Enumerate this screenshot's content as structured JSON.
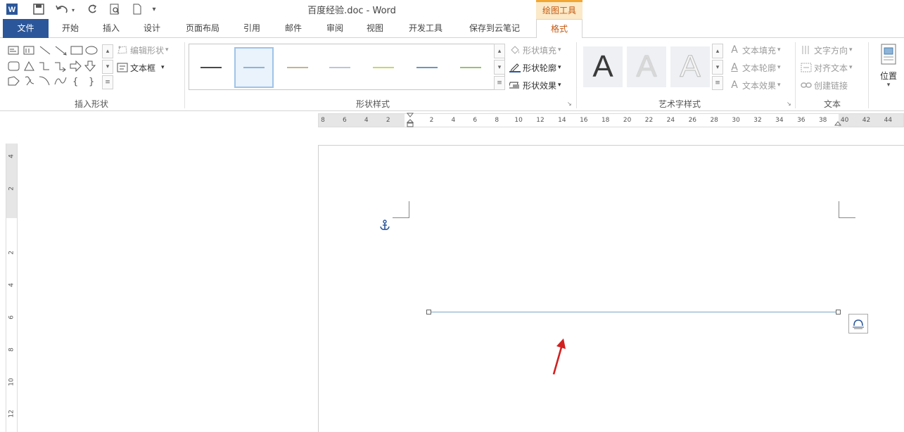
{
  "title": "百度经验.doc - Word",
  "contextual_header": "绘图工具",
  "tabs": [
    "文件",
    "开始",
    "插入",
    "设计",
    "页面布局",
    "引用",
    "邮件",
    "审阅",
    "视图",
    "开发工具",
    "保存到云笔记",
    "格式"
  ],
  "quick_access": {
    "save": "save-icon",
    "undo": "undo-icon",
    "redo": "redo-icon",
    "preview": "print-preview-icon",
    "new": "new-document-icon",
    "more": "▾"
  },
  "ribbon": {
    "insert_shapes": {
      "edit_shape": "编辑形状",
      "text_box": "文本框",
      "label": "插入形状"
    },
    "shape_styles": {
      "fill": "形状填充",
      "outline": "形状轮廓",
      "effects": "形状效果",
      "label": "形状样式",
      "swatch_colors": [
        "#4a4a4a",
        "#8eb4d8",
        "#c6b48a",
        "#b8c8d8",
        "#c8d860",
        "#6a98c0",
        "#9cc070"
      ]
    },
    "wordart": {
      "text_fill": "文本填充",
      "text_outline": "文本轮廓",
      "text_effects": "文本效果",
      "label": "艺术字样式",
      "glyph": "A"
    },
    "text": {
      "direction": "文字方向",
      "align": "对齐文本",
      "link": "创建链接",
      "label": "文本"
    },
    "position": {
      "label": "位置"
    }
  },
  "ruler_h": [
    "8",
    "6",
    "4",
    "2",
    "",
    "2",
    "4",
    "6",
    "8",
    "10",
    "12",
    "14",
    "16",
    "18",
    "20",
    "22",
    "24",
    "26",
    "28",
    "30",
    "32",
    "34",
    "36",
    "38",
    "40",
    "42",
    "44"
  ],
  "ruler_v": [
    "4",
    "2",
    "",
    "2",
    "4",
    "6",
    "8",
    "10",
    "12"
  ],
  "ruler_tab_glyph": "L",
  "colors": {
    "file_tab": "#2b579a",
    "context_accent": "#f2a633",
    "context_text": "#c55a11",
    "line": "#7aa6c8",
    "arrow": "#d22020"
  }
}
